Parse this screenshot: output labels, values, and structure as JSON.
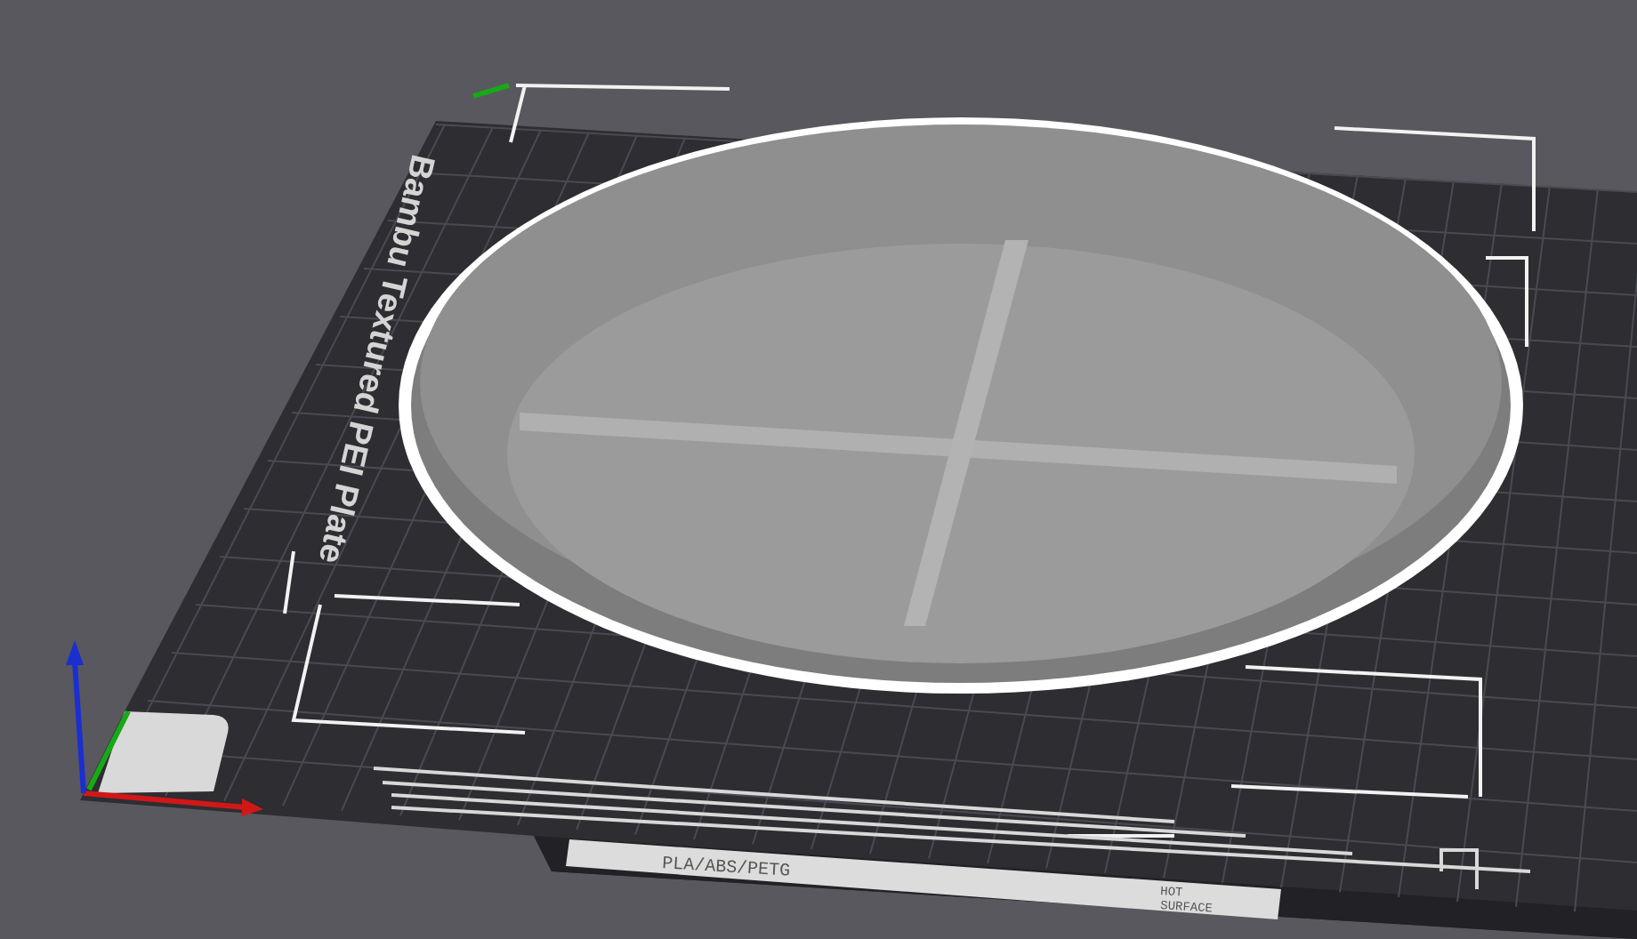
{
  "viewport": {
    "plate_name": "Bambu Textured PEI Plate",
    "plate_label": {
      "filaments": "PLA/ABS/PETG",
      "warning_lines": [
        "HOT",
        "SURFACE"
      ]
    }
  }
}
